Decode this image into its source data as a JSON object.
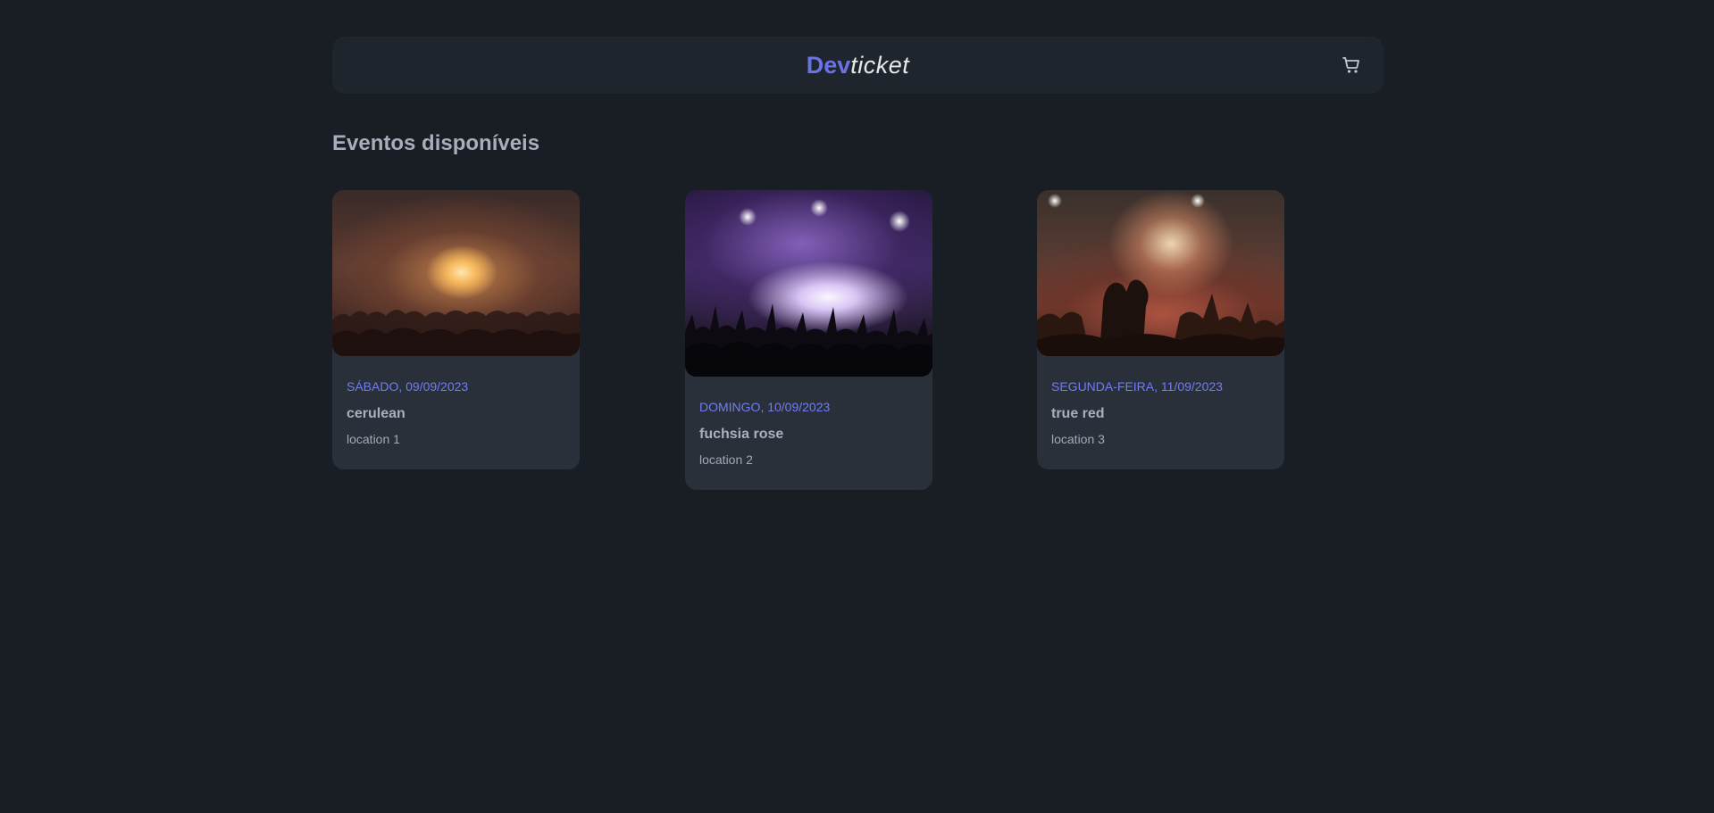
{
  "header": {
    "logo_dev": "Dev",
    "logo_ticket": "ticket",
    "cart_icon": "cart-icon"
  },
  "main": {
    "title": "Eventos disponíveis",
    "events": [
      {
        "date": "SÁBADO, 09/09/2023",
        "name": "cerulean",
        "location": "location 1",
        "image_icon": "concert-photo"
      },
      {
        "date": "DOMINGO, 10/09/2023",
        "name": "fuchsia rose",
        "location": "location 2",
        "image_icon": "concert-photo"
      },
      {
        "date": "SEGUNDA-FEIRA, 11/09/2023",
        "name": "true red",
        "location": "location 3",
        "image_icon": "concert-photo"
      }
    ]
  },
  "colors": {
    "background": "#191e24",
    "header_bg": "#1f252c",
    "card_bg": "#29303a",
    "accent": "#6a73e6",
    "date_text": "#717cf4"
  }
}
